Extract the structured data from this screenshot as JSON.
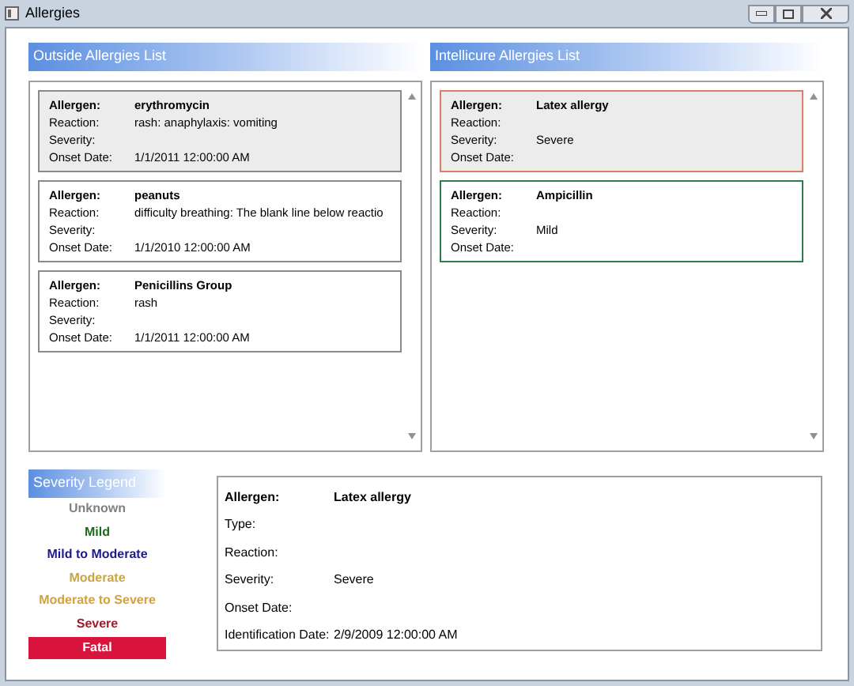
{
  "window": {
    "title": "Allergies"
  },
  "outside": {
    "title": "Outside Allergies List",
    "items": [
      {
        "selected": true,
        "fields": [
          {
            "label": "Allergen:",
            "value": "erythromycin"
          },
          {
            "label": "Reaction:",
            "value": "rash: anaphylaxis: vomiting"
          },
          {
            "label": "Severity:"
          },
          {
            "label": "Onset Date:",
            "value": "1/1/2011 12:00:00 AM"
          }
        ]
      },
      {
        "selected": false,
        "fields": [
          {
            "label": "Allergen:",
            "value": "peanuts"
          },
          {
            "label": "Reaction:",
            "value": "difficulty breathing: The blank line below reactio"
          },
          {
            "label": "Severity:"
          },
          {
            "label": "Onset Date:",
            "value": "1/1/2010 12:00:00 AM"
          }
        ]
      },
      {
        "selected": false,
        "fields": [
          {
            "label": "Allergen:",
            "value": "Penicillins Group"
          },
          {
            "label": "Reaction:",
            "value": "rash"
          },
          {
            "label": "Severity:"
          },
          {
            "label": "Onset Date:",
            "value": "1/1/2011 12:00:00 AM"
          }
        ]
      }
    ]
  },
  "intellicure": {
    "title": "Intellicure Allergies List",
    "items": [
      {
        "selected": true,
        "color": "#e07a6a",
        "fields": [
          {
            "label": "Allergen:",
            "value": "Latex allergy"
          },
          {
            "label": "Reaction:"
          },
          {
            "label": "Severity:",
            "value": "Severe"
          },
          {
            "label": "Onset Date:"
          }
        ]
      },
      {
        "selected": false,
        "color": "#2e7d4f",
        "fields": [
          {
            "label": "Allergen:",
            "value": "Ampicillin"
          },
          {
            "label": "Reaction:"
          },
          {
            "label": "Severity:",
            "value": "Mild"
          },
          {
            "label": "Onset Date:"
          }
        ]
      }
    ]
  },
  "legend": {
    "title": "Severity Legend",
    "items": [
      {
        "label": "Unknown",
        "kind": "text",
        "color": "#808080"
      },
      {
        "label": "Mild",
        "kind": "text",
        "color": "#1a6b1a"
      },
      {
        "label": "Mild to Moderate",
        "kind": "text",
        "color": "#1a1a8c"
      },
      {
        "label": "Moderate",
        "kind": "text",
        "color": "#c8a640"
      },
      {
        "label": "Moderate to Severe",
        "kind": "text",
        "color": "#d4a23c"
      },
      {
        "label": "Severe",
        "kind": "text",
        "color": "#a01c28"
      },
      {
        "label": "Fatal",
        "kind": "filled",
        "color": "#d8143c"
      }
    ]
  },
  "detail": {
    "fields": [
      {
        "label": "Allergen:",
        "value": "Latex allergy"
      },
      {
        "label": "Type:"
      },
      {
        "label": "Reaction:"
      },
      {
        "label": "Severity:",
        "value": "Severe"
      },
      {
        "label": "Onset Date:"
      },
      {
        "label": "Identification Date:",
        "value": "2/9/2009 12:00:00 AM"
      }
    ]
  }
}
